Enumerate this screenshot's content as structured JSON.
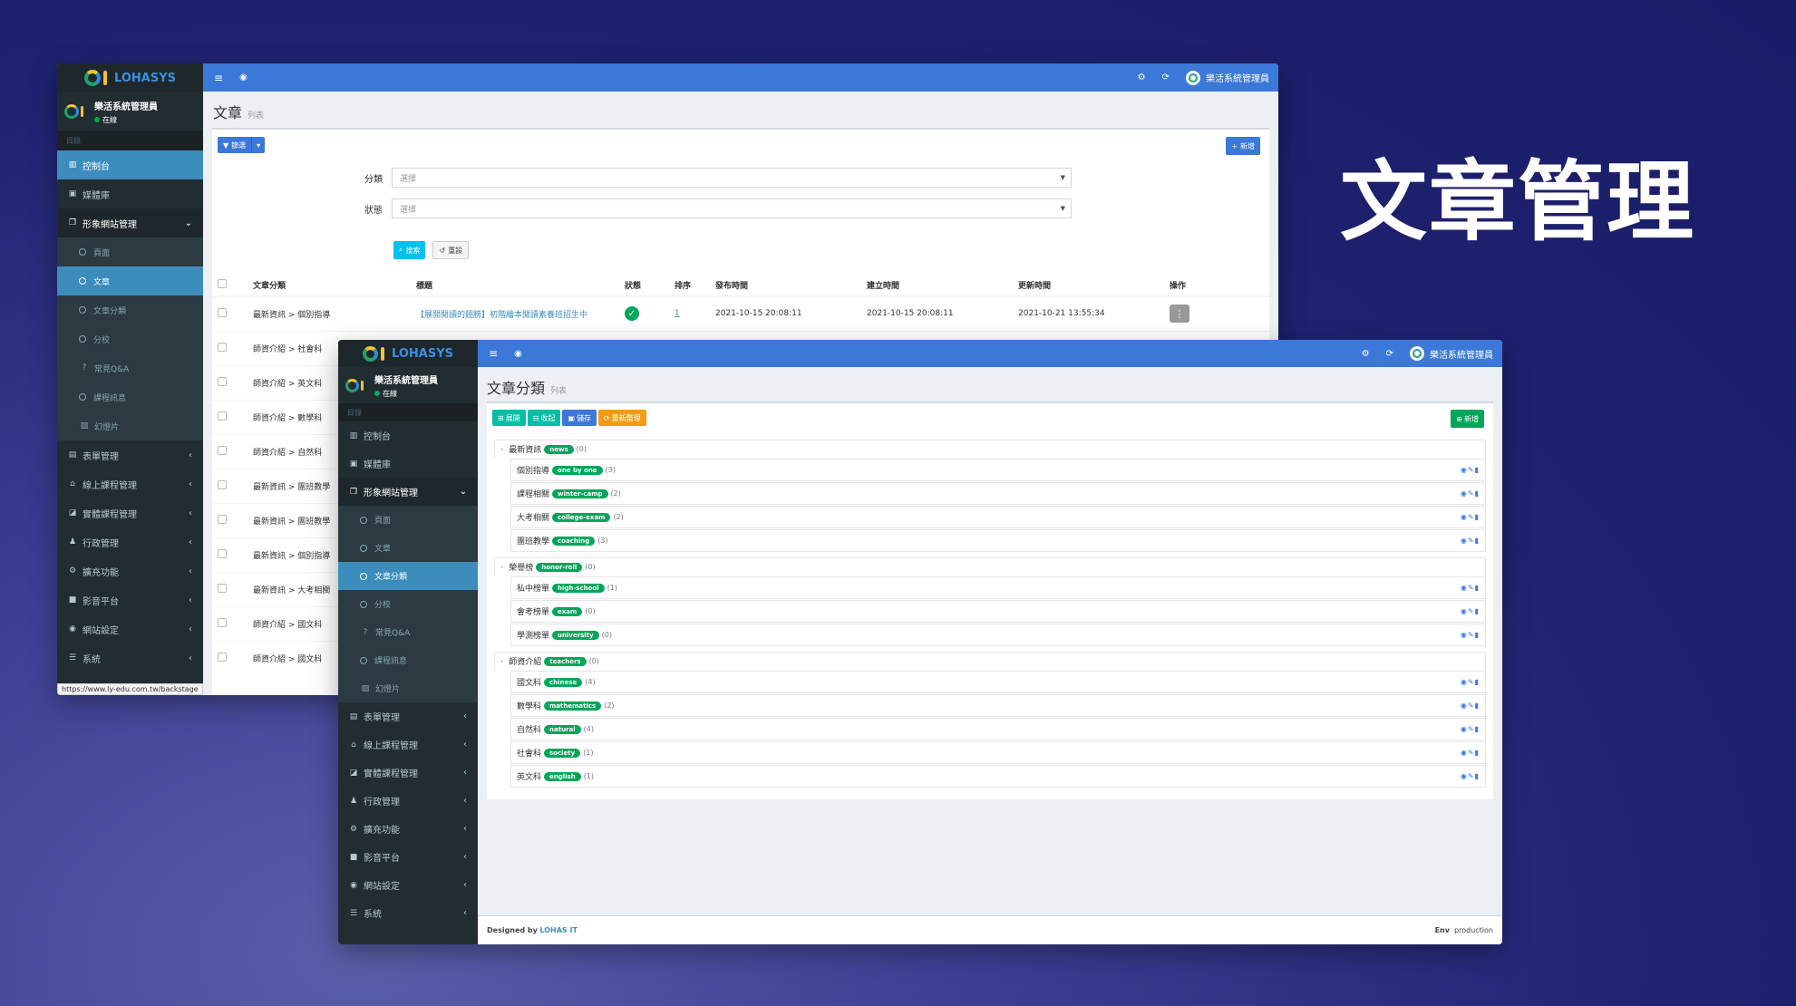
{
  "hero_title": "文章管理",
  "brand": {
    "name": "LOHASYS"
  },
  "user": {
    "name": "樂活系統管理員",
    "status": "在線"
  },
  "sidebar": {
    "header": "目錄",
    "items": {
      "dashboard": "控制台",
      "media": "媒體庫",
      "site": "形象網站管理",
      "sub_pages": "頁面",
      "sub_articles": "文章",
      "sub_categories": "文章分類",
      "sub_branches": "分校",
      "sub_faq": "常見Q&A",
      "sub_courses": "課程訊息",
      "sub_slides": "幻燈片",
      "forms": "表單管理",
      "online": "線上課程管理",
      "physical": "實體課程管理",
      "admin": "行政管理",
      "ext": "擴充功能",
      "video": "影音平台",
      "settings": "網站設定",
      "system": "系統"
    }
  },
  "win1": {
    "page_title": "文章",
    "page_sub": "列表",
    "filter_label": "篩選",
    "add_label": "新增",
    "category_label": "分類",
    "status_label": "狀態",
    "select_placeholder": "選擇",
    "search_label": "搜索",
    "reset_label": "重設",
    "columns": {
      "category": "文章分類",
      "title": "標題",
      "status": "狀態",
      "sort": "排序",
      "published": "發布時間",
      "created": "建立時間",
      "updated": "更新時間",
      "ops": "操作"
    },
    "rows": [
      {
        "category": "最新資訊 > 個別指導",
        "title": "【展開閱讀的翅膀】初階繪本閱讀素養班招生中",
        "sort": "1",
        "published": "2021-10-15 20:08:11",
        "created": "2021-10-15 20:08:11",
        "updated": "2021-10-21 13:55:34"
      },
      {
        "category": "師資介紹 > 社會科"
      },
      {
        "category": "師資介紹 > 英文科"
      },
      {
        "category": "師資介紹 > 數學科"
      },
      {
        "category": "師資介紹 > 自然科"
      },
      {
        "category": "最新資訊 > 團班教學"
      },
      {
        "category": "最新資訊 > 團班教學"
      },
      {
        "category": "最新資訊 > 個別指導"
      },
      {
        "category": "最新資訊 > 大考相關"
      },
      {
        "category": "師資介紹 > 國文科"
      },
      {
        "category": "師資介紹 > 國文科"
      }
    ],
    "status_url": "https://www.ly-edu.com.tw/backstage"
  },
  "win2": {
    "page_title": "文章分類",
    "page_sub": "列表",
    "btn_expand": "展開",
    "btn_collapse": "收起",
    "btn_save": "儲存",
    "btn_rebuild": "重新整理",
    "btn_add": "新增",
    "tree": [
      {
        "name": "最新資訊",
        "slug": "news",
        "count": "(0)",
        "level": 0
      },
      {
        "name": "個別指導",
        "slug": "one by one",
        "count": "(3)",
        "level": 1
      },
      {
        "name": "課程相關",
        "slug": "winter-camp",
        "count": "(2)",
        "level": 1
      },
      {
        "name": "大考相關",
        "slug": "college-exam",
        "count": "(2)",
        "level": 1
      },
      {
        "name": "團班教學",
        "slug": "coaching",
        "count": "(3)",
        "level": 1
      },
      {
        "name": "榮譽榜",
        "slug": "honor-roll",
        "count": "(0)",
        "level": 0
      },
      {
        "name": "私中榜單",
        "slug": "high-school",
        "count": "(1)",
        "level": 1
      },
      {
        "name": "會考榜單",
        "slug": "exam",
        "count": "(0)",
        "level": 1
      },
      {
        "name": "學測榜單",
        "slug": "university",
        "count": "(0)",
        "level": 1
      },
      {
        "name": "師資介紹",
        "slug": "teachers",
        "count": "(0)",
        "level": 0
      },
      {
        "name": "國文科",
        "slug": "chinese",
        "count": "(4)",
        "level": 1
      },
      {
        "name": "數學科",
        "slug": "mathematics",
        "count": "(2)",
        "level": 1
      },
      {
        "name": "自然科",
        "slug": "natural",
        "count": "(4)",
        "level": 1
      },
      {
        "name": "社會科",
        "slug": "society",
        "count": "(1)",
        "level": 1
      },
      {
        "name": "英文科",
        "slug": "english",
        "count": "(1)",
        "level": 1
      }
    ],
    "footer_designed": "Designed by",
    "footer_brand": "LOHAS IT",
    "footer_env_label": "Env",
    "footer_env_value": "production"
  },
  "colors": {
    "topbar": "#3c78d8",
    "sidebar": "#222d32",
    "active": "#3c8dbc",
    "badge": "#00a65a"
  }
}
